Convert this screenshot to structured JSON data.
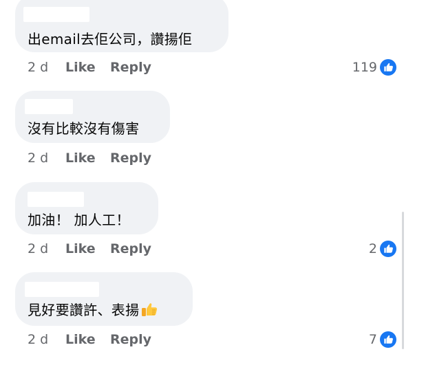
{
  "comments": [
    {
      "text": "出email去佢公司，讚揚佢",
      "time": "2 d",
      "like_label": "Like",
      "reply_label": "Reply",
      "reactions": "119"
    },
    {
      "text": "沒有比較沒有傷害",
      "time": "2 d",
      "like_label": "Like",
      "reply_label": "Reply",
      "reactions": ""
    },
    {
      "text": "加油！ 加人工！",
      "time": "2 d",
      "like_label": "Like",
      "reply_label": "Reply",
      "reactions": "2"
    },
    {
      "text": "見好要讚許、表揚",
      "text_emoji": "thumbs-up-emoji",
      "time": "2 d",
      "like_label": "Like",
      "reply_label": "Reply",
      "reactions": "7"
    }
  ],
  "colors": {
    "bubble": "#f0f2f5",
    "meta_text": "#65676b",
    "like_blue": "#1877f2"
  },
  "icons": {
    "reaction": "like-reaction-icon",
    "emoji": "thumbs-up-emoji"
  }
}
